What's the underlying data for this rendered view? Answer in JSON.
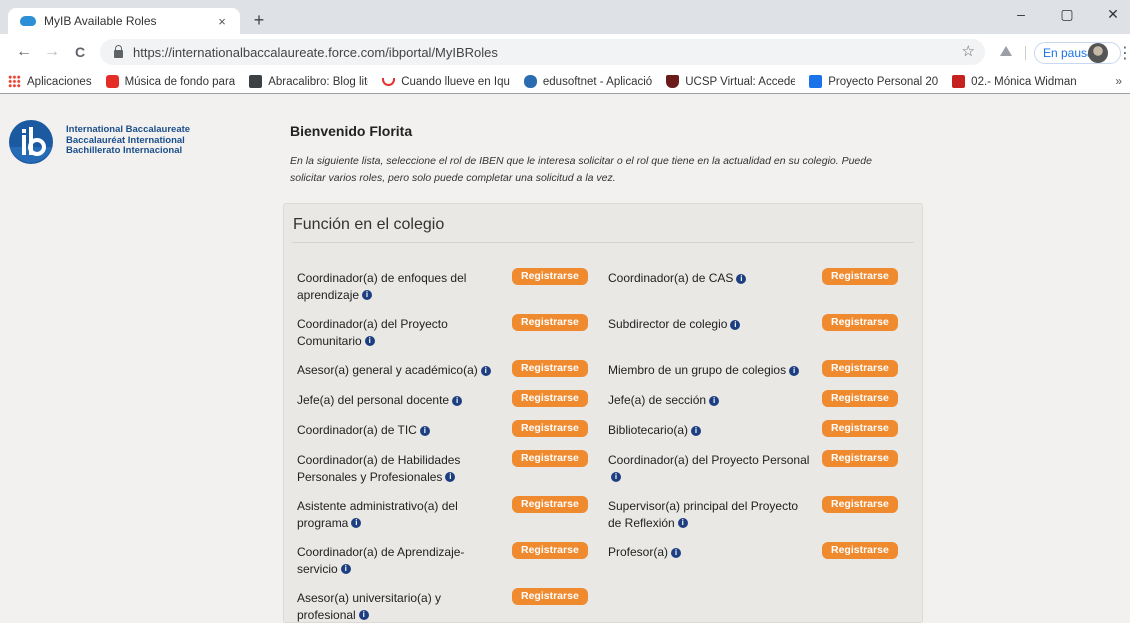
{
  "browser": {
    "tab_title": "MyIB Available Roles",
    "tab_close": "×",
    "new_tab": "+",
    "window_controls": [
      "–",
      "▢",
      "✕"
    ],
    "back": "←",
    "forward": "→",
    "reload": "C",
    "url": "https://internationalbaccalaureate.force.com/ibportal/MyIBRoles",
    "star": "☆",
    "pause_label": "En pausa",
    "menu": "⋮",
    "bookmarks_more": "»",
    "bookmarks": [
      {
        "label": "Aplicaciones",
        "color": "#f2a60c"
      },
      {
        "label": "Música de fondo para",
        "color": "#e52d27"
      },
      {
        "label": "Abracalibro: Blog lite",
        "color": "#3c4043"
      },
      {
        "label": "Cuando llueve en Iqu",
        "color": "#e4342f"
      },
      {
        "label": "edusoftnet - Aplicació",
        "color": "#2b6cb0"
      },
      {
        "label": "UCSP Virtual: Accede",
        "color": "#6b1a1a"
      },
      {
        "label": "Proyecto Personal 20",
        "color": "#1a73e8"
      },
      {
        "label": "02.- Mónica Widman",
        "color": "#c5221f"
      }
    ]
  },
  "page": {
    "logo_lines": [
      "International Baccalaureate",
      "Baccalauréat International",
      "Bachillerato Internacional"
    ],
    "welcome": "Bienvenido Florita",
    "intro": "En la siguiente lista, seleccione el rol de IBEN que le interesa solicitar o el rol que tiene en la actualidad en su colegio. Puede solicitar varios roles, pero solo puede completar una solicitud a la vez.",
    "panel_title": "Función en el colegio",
    "register_label": "Registrarse",
    "info_glyph": "i",
    "roles_left": [
      "Coordinador(a) de enfoques del aprendizaje",
      "Coordinador(a) del Proyecto Comunitario",
      "Asesor(a) general y académico(a)",
      "Jefe(a) del personal docente",
      "Coordinador(a) de TIC",
      "Coordinador(a) de Habilidades Personales y Profesionales",
      "Asistente administrativo(a) del programa",
      "Coordinador(a) de Aprendizaje-servicio",
      "Asesor(a) universitario(a) y profesional"
    ],
    "roles_right": [
      "Coordinador(a) de CAS",
      "Subdirector de colegio",
      "Miembro de un grupo de colegios",
      "Jefe(a) de sección",
      "Bibliotecario(a)",
      "Coordinador(a) del Proyecto Personal",
      "Supervisor(a) principal del Proyecto de Reflexión",
      "Profesor(a)"
    ]
  }
}
